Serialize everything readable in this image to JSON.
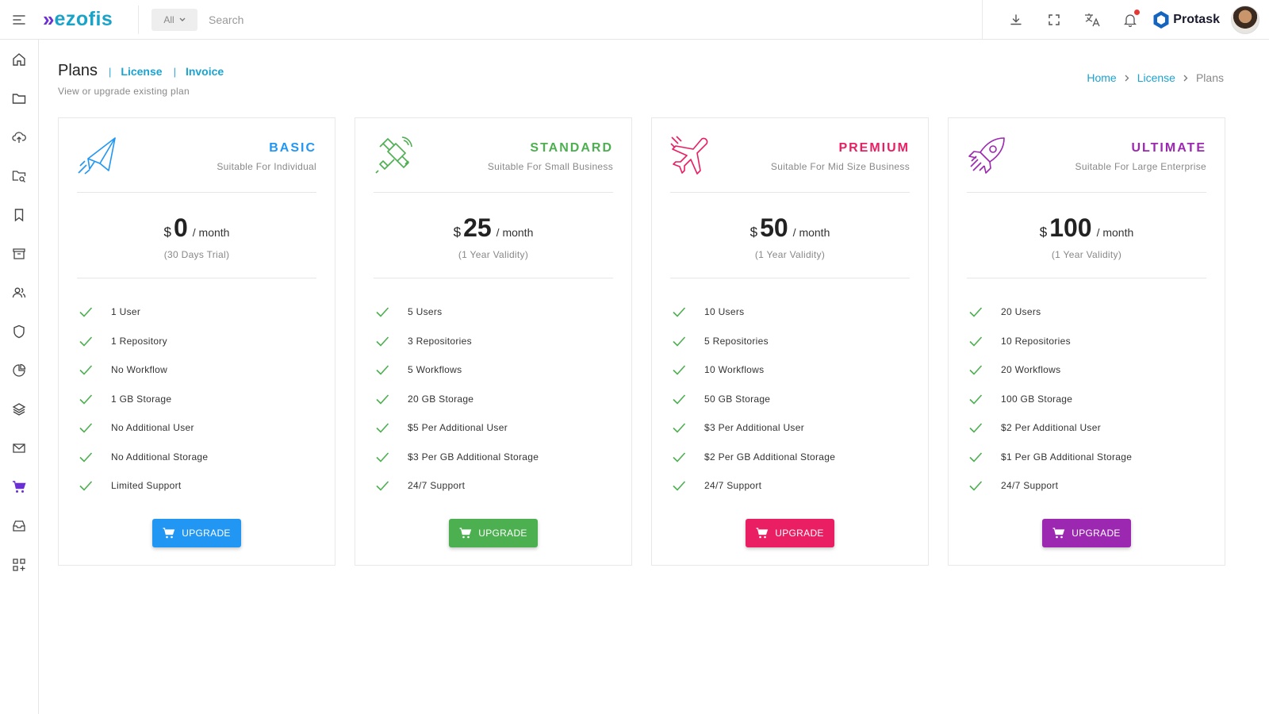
{
  "app": {
    "logo_text": "ezofis",
    "scope_label": "All",
    "search_placeholder": "Search",
    "brand_text": "Protask"
  },
  "header": {
    "title": "Plans",
    "links": [
      "License",
      "Invoice"
    ],
    "subtitle": "View or upgrade existing plan"
  },
  "breadcrumb": {
    "items": [
      "Home",
      "License"
    ],
    "current": "Plans"
  },
  "sidebar": {
    "icons": [
      "home-icon",
      "folder-icon",
      "upload-icon",
      "folder-search-icon",
      "bookmark-icon",
      "archive-icon",
      "users-icon",
      "shield-icon",
      "pie-chart-icon",
      "layers-icon",
      "mail-icon",
      "cart-icon",
      "inbox-icon",
      "apps-add-icon"
    ],
    "active_index": 11
  },
  "topbar_icons": [
    "download-icon",
    "fullscreen-icon",
    "translate-icon",
    "bell-icon"
  ],
  "plans": [
    {
      "name": "BASIC",
      "desc": "Suitable For Individual",
      "currency": "$",
      "amount": "0",
      "period": "/ month",
      "validity": "(30 Days Trial)",
      "color": "#2196f3",
      "icon": "paper-plane-icon",
      "features": [
        "1 User",
        "1 Repository",
        "No Workflow",
        "1 GB Storage",
        "No Additional User",
        "No Additional Storage",
        "Limited Support"
      ],
      "button": "UPGRADE"
    },
    {
      "name": "STANDARD",
      "desc": "Suitable For Small Business",
      "currency": "$",
      "amount": "25",
      "period": "/ month",
      "validity": "(1 Year Validity)",
      "color": "#4caf50",
      "icon": "satellite-icon",
      "features": [
        "5 Users",
        "3 Repositories",
        "5 Workflows",
        "20 GB Storage",
        "$5 Per Additional User",
        "$3 Per GB Additional Storage",
        "24/7 Support"
      ],
      "button": "UPGRADE"
    },
    {
      "name": "PREMIUM",
      "desc": "Suitable For Mid Size Business",
      "currency": "$",
      "amount": "50",
      "period": "/ month",
      "validity": "(1 Year Validity)",
      "color": "#e91e63",
      "icon": "airplane-icon",
      "features": [
        "10 Users",
        "5 Repositories",
        "10 Workflows",
        "50 GB Storage",
        "$3 Per Additional User",
        "$2 Per GB Additional Storage",
        "24/7 Support"
      ],
      "button": "UPGRADE"
    },
    {
      "name": "ULTIMATE",
      "desc": "Suitable For Large Enterprise",
      "currency": "$",
      "amount": "100",
      "period": "/ month",
      "validity": "(1 Year Validity)",
      "color": "#9c27b0",
      "icon": "rocket-icon",
      "features": [
        "20 Users",
        "10 Repositories",
        "20 Workflows",
        "100 GB Storage",
        "$2 Per Additional User",
        "$1 Per GB Additional Storage",
        "24/7 Support"
      ],
      "button": "UPGRADE"
    }
  ],
  "colors": {
    "accent": "#1ba3d1",
    "check": "#4caf50",
    "logo_mark": "#6b2fd6",
    "sidebar_active": "#6b2fd6",
    "notification": "#e53935"
  }
}
